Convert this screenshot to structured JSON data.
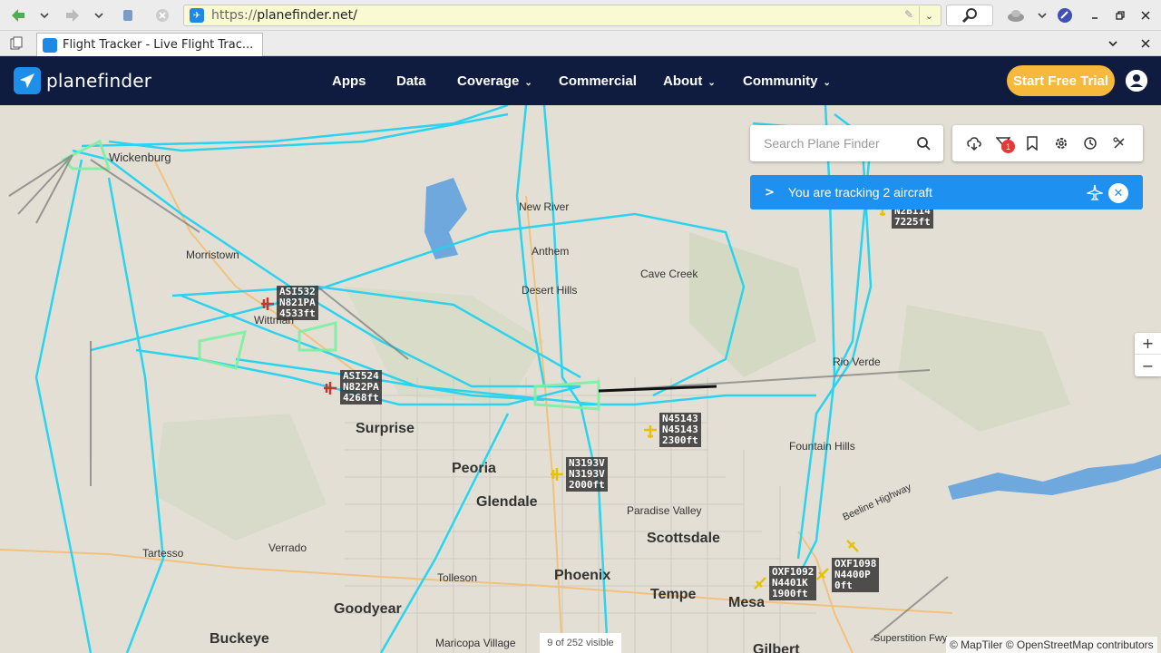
{
  "browser": {
    "url_proto": "https://",
    "url_host": "planefinder.net/",
    "tab_title": "Flight Tracker - Live Flight Trac..."
  },
  "header": {
    "logo_text": "planefinder",
    "nav": [
      {
        "label": "Apps",
        "has_menu": false
      },
      {
        "label": "Data",
        "has_menu": false
      },
      {
        "label": "Coverage",
        "has_menu": true
      },
      {
        "label": "Commercial",
        "has_menu": false
      },
      {
        "label": "About",
        "has_menu": true
      },
      {
        "label": "Community",
        "has_menu": true
      }
    ],
    "trial_label": "Start Free Trial"
  },
  "map": {
    "search_placeholder": "Search Plane Finder",
    "alerts_badge": "1",
    "tracking_text": "You are tracking 2 aircraft",
    "zoom_in": "+",
    "zoom_out": "−",
    "visible_count": "9 of 252 visible",
    "attribution": "© MapTiler © OpenStreetMap contributors",
    "places": {
      "wickenburg": "Wickenburg",
      "morristown": "Morristown",
      "wittmann": "Wittman",
      "new_river": "New River",
      "anthem": "Anthem",
      "desert_hills": "Desert Hills",
      "cave_creek": "Cave Creek",
      "rio_verde": "Rio Verde",
      "fountain_hills": "Fountain Hills",
      "surprise": "Surprise",
      "peoria": "Peoria",
      "glendale": "Glendale",
      "paradise_valley": "Paradise Valley",
      "scottsdale": "Scottsdale",
      "tartesso": "Tartesso",
      "verrado": "Verrado",
      "tolleson": "Tolleson",
      "phoenix": "Phoenix",
      "tempe": "Tempe",
      "mesa": "Mesa",
      "goodyear": "Goodyear",
      "buckeye": "Buckeye",
      "maricopa_village": "Maricopa Village",
      "gilbert": "Gilbert",
      "beeline": "Beeline Highway",
      "superstition": "Superstition Fwy"
    },
    "aircraft": [
      {
        "label": "ASI532\nN821PA\n4533ft",
        "color": "#c0392b"
      },
      {
        "label": "ASI524\nN822PA\n4268ft",
        "color": "#c0392b"
      },
      {
        "label": "N45143\nN45143\n2300ft",
        "color": "#e6c200"
      },
      {
        "label": "N3193V\nN3193V\n2000ft",
        "color": "#e6c200"
      },
      {
        "label": "OXF1092\nN4401K\n1900ft",
        "color": "#e6c200"
      },
      {
        "label": "OXF1098\nN4400P\n0ft",
        "color": "#e6c200"
      },
      {
        "label": "N2B114\n7225ft",
        "color": "#e6c200"
      }
    ]
  }
}
